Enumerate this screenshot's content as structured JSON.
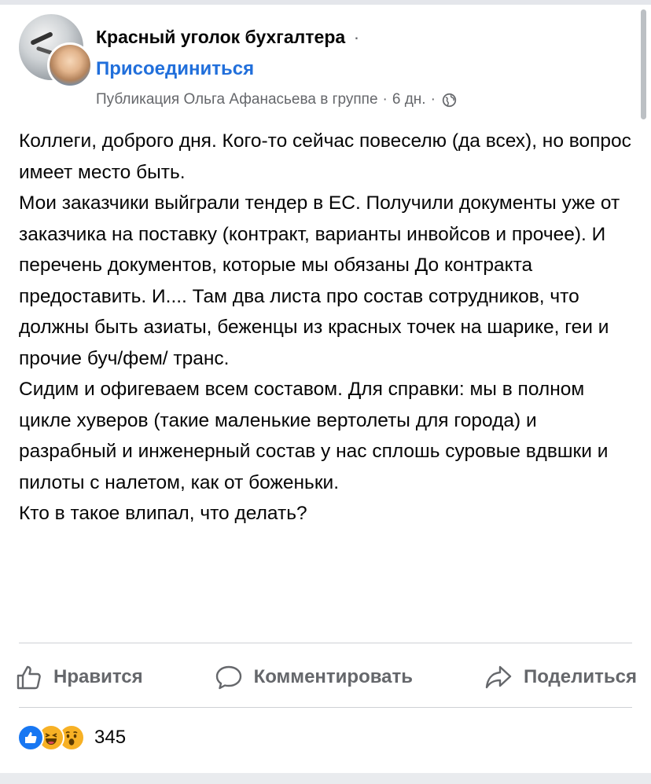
{
  "header": {
    "group_name": "Красный уголок бухгалтера",
    "separator": "·",
    "join_label": "Присоединиться",
    "meta_text": "Публикация Ольга Афанасьева в группе",
    "meta_dot": "·",
    "time_ago": "6 дн.",
    "meta_dot2": "·",
    "privacy_icon": "globe-icon"
  },
  "post": {
    "paragraphs": [
      "Коллеги, доброго дня. Кого-то сейчас повеселю (да всех), но вопрос имеет место быть.",
      "Мои заказчики выйграли тендер в ЕС. Получили документы уже от заказчика на поставку (контракт, варианты инвойсов и прочее). И перечень документов, которые мы обязаны До контракта предоставить. И.... Там два листа про состав сотрудников, что должны быть азиаты, беженцы из красных точек на шарике, геи и прочие буч/фем/ транс.",
      "Сидим и офигеваем всем составом. Для справки: мы в полном цикле хуверов (такие маленькие вертолеты для города) и разрабный и инженерный состав у нас сплошь суровые вдвшки и пилоты с налетом, как от боженьки.",
      "Кто в такое влипал, что делать?"
    ]
  },
  "actions": {
    "like_label": "Нравится",
    "comment_label": "Комментировать",
    "share_label": "Поделиться"
  },
  "reactions": {
    "types": [
      "like-icon",
      "haha-icon",
      "wow-icon"
    ],
    "count": "345"
  },
  "colors": {
    "link_blue": "#216fdb",
    "secondary_text": "#65676b",
    "like_blue": "#1877f2",
    "emoji_yellow": "#f7b125"
  }
}
